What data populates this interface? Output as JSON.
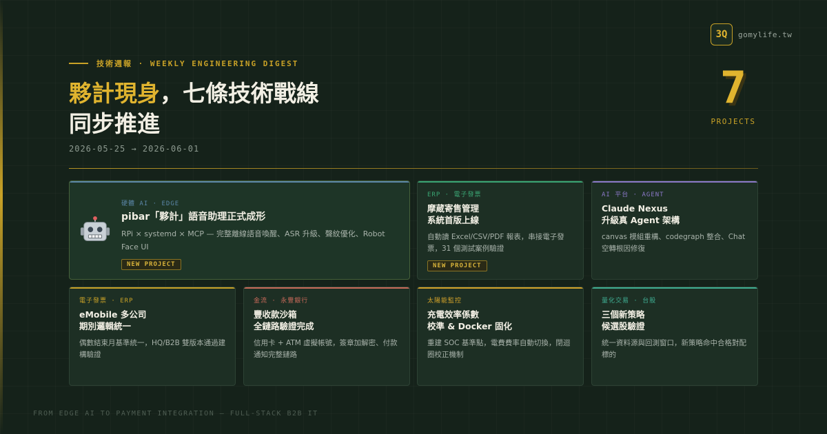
{
  "header": {
    "eyebrow": "技術週報 · WEEKLY ENGINEERING DIGEST",
    "title_highlight": "夥計現身",
    "title_rest_line1": "，七條技術戰線",
    "title_line2": "同步推進",
    "date_range": "2026-05-25 → 2026-06-01"
  },
  "brand": {
    "logo": "3Q",
    "site": "gomylife.tw"
  },
  "stats": {
    "count": "7",
    "label": "PROJECTS"
  },
  "cards": [
    {
      "tag": "硬體 AI · EDGE",
      "title": "pibar「夥計」語音助理正式成形",
      "desc": "RPi × systemd × MCP — 完整離線語音喚醒、ASR 升級、聲紋優化、Robot Face UI",
      "badge": "NEW PROJECT",
      "icon": "robot-icon",
      "accent": "#5b86a8"
    },
    {
      "tag": "ERP · 電子發票",
      "title": "摩蔵寄售管理\n系統首版上線",
      "desc": "自動讀 Excel/CSV/PDF 報表，串接電子發票，31 個測試案例驗證",
      "badge": "NEW PROJECT",
      "accent": "#3aa573"
    },
    {
      "tag": "AI 平台 · AGENT",
      "title": "Claude Nexus\n升級真 Agent 架構",
      "desc": "canvas 模組重構、codegraph 整合、Chat 空轉根因修復",
      "accent": "#8b78c8"
    },
    {
      "tag": "電子發票 · ERP",
      "title": "eMobile 多公司\n期別邏輯統一",
      "desc": "偶數結束月基準統一，HQ/B2B 雙版本通過建構驗證",
      "accent": "#c9a227"
    },
    {
      "tag": "金流 · 永豐銀行",
      "title": "豐收款沙箱\n全鏈路驗證完成",
      "desc": "信用卡 + ATM 虛擬帳號，簽章加解密、付款通知完整鏈路",
      "accent": "#c96a5a"
    },
    {
      "tag": "太陽能監控",
      "title": "充電效率係數\n校準 & Docker 固化",
      "desc": "重建 SOC 基準點，電費費率自動切換，閉迴圈校正機制",
      "accent": "#d4a32a"
    },
    {
      "tag": "量化交易 · 台股",
      "title": "三個新策略\n候選股驗證",
      "desc": "統一資料源與回測窗口，新策略命中合格對配標的",
      "accent": "#3fae93"
    }
  ],
  "footer": "FROM EDGE AI TO PAYMENT INTEGRATION — FULL-STACK B2B IT"
}
